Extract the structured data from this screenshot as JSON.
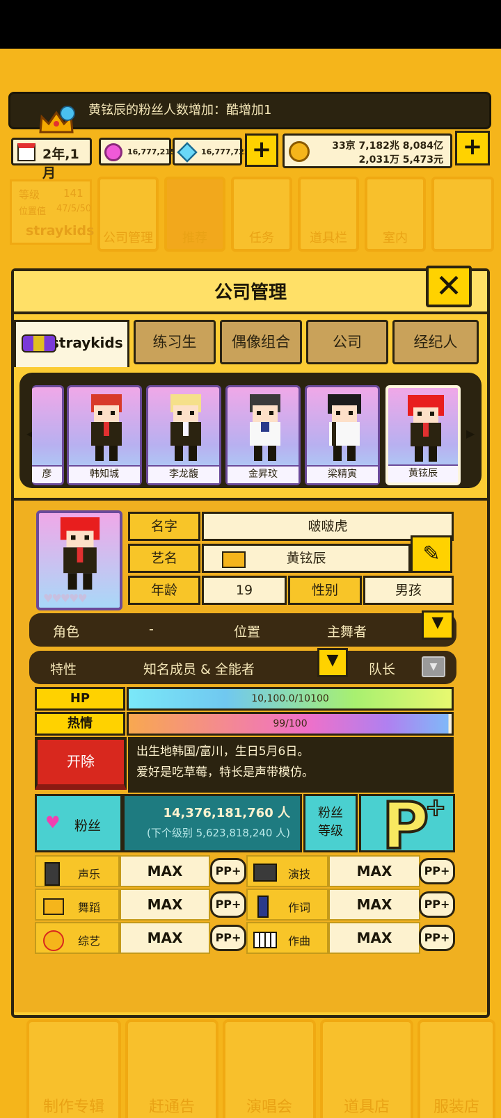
{
  "notice": {
    "text": "黄铉辰的粉丝人数增加：酷增加1"
  },
  "stats": {
    "date": "2年,1月",
    "gem_pink": "16,777,215",
    "gem_blue": "16,777,722",
    "money_line1": "33京 7,182兆 8,084亿",
    "money_line2": "2,031万 5,473元"
  },
  "profile_mini": {
    "level_label": "等级",
    "level_value": "141",
    "position_label": "位置值",
    "position_value": "47/5/50",
    "group_name": "straykids"
  },
  "menu_bg": [
    "公司管理",
    "推荐",
    "任务",
    "道具栏",
    "室内"
  ],
  "panel": {
    "title": "公司管理",
    "tabs": [
      "straykids",
      "练习生",
      "偶像组合",
      "公司",
      "经纪人"
    ],
    "members": [
      "韩知城",
      "李龙馥",
      "金昇玟",
      "梁精寅",
      "黄铉辰"
    ],
    "member_partial": "彦"
  },
  "info": {
    "name_label": "名字",
    "name_value": "啵啵虎",
    "stage_label": "艺名",
    "stage_value": "黄铉辰",
    "age_label": "年龄",
    "age_value": "19",
    "gender_label": "性别",
    "gender_value": "男孩",
    "role_label": "角色",
    "role_value": "-",
    "position_label": "位置",
    "position_value": "主舞者",
    "trait_label": "特性",
    "trait_value": "知名成员 & 全能者",
    "leader_label": "队长"
  },
  "bars": {
    "hp_label": "HP",
    "hp_value": "10,100.0/10100",
    "hp_fraction": 1.0,
    "passion_label": "热情",
    "passion_value": "99/100",
    "passion_fraction": 0.99
  },
  "fire_button": "开除",
  "bio": {
    "line1": "出生地韩国/富川，生日5月6日。",
    "line2": "爱好是吃草莓，特长是声带模仿。"
  },
  "fans": {
    "label": "粉丝",
    "count": "14,376,181,760 人",
    "next": "(下个级别 5,623,818,240 人)",
    "level_label_1": "粉丝",
    "level_label_2": "等级",
    "level_badge": "P"
  },
  "skills": [
    {
      "name": "声乐",
      "value": "MAX",
      "pp": "PP+"
    },
    {
      "name": "演技",
      "value": "MAX",
      "pp": "PP+"
    },
    {
      "name": "舞蹈",
      "value": "MAX",
      "pp": "PP+"
    },
    {
      "name": "作词",
      "value": "MAX",
      "pp": "PP+"
    },
    {
      "name": "综艺",
      "value": "MAX",
      "pp": "PP+"
    },
    {
      "name": "作曲",
      "value": "MAX",
      "pp": "PP+"
    }
  ],
  "bottom_nav": [
    "制作专辑",
    "赶通告",
    "演唱会",
    "道具店",
    "服装店"
  ],
  "colors": {
    "bg": "#f5b51b",
    "panel": "#fccc34",
    "dark": "#2b2310",
    "teal": "#1e7b80",
    "fire": "#d8281e"
  }
}
